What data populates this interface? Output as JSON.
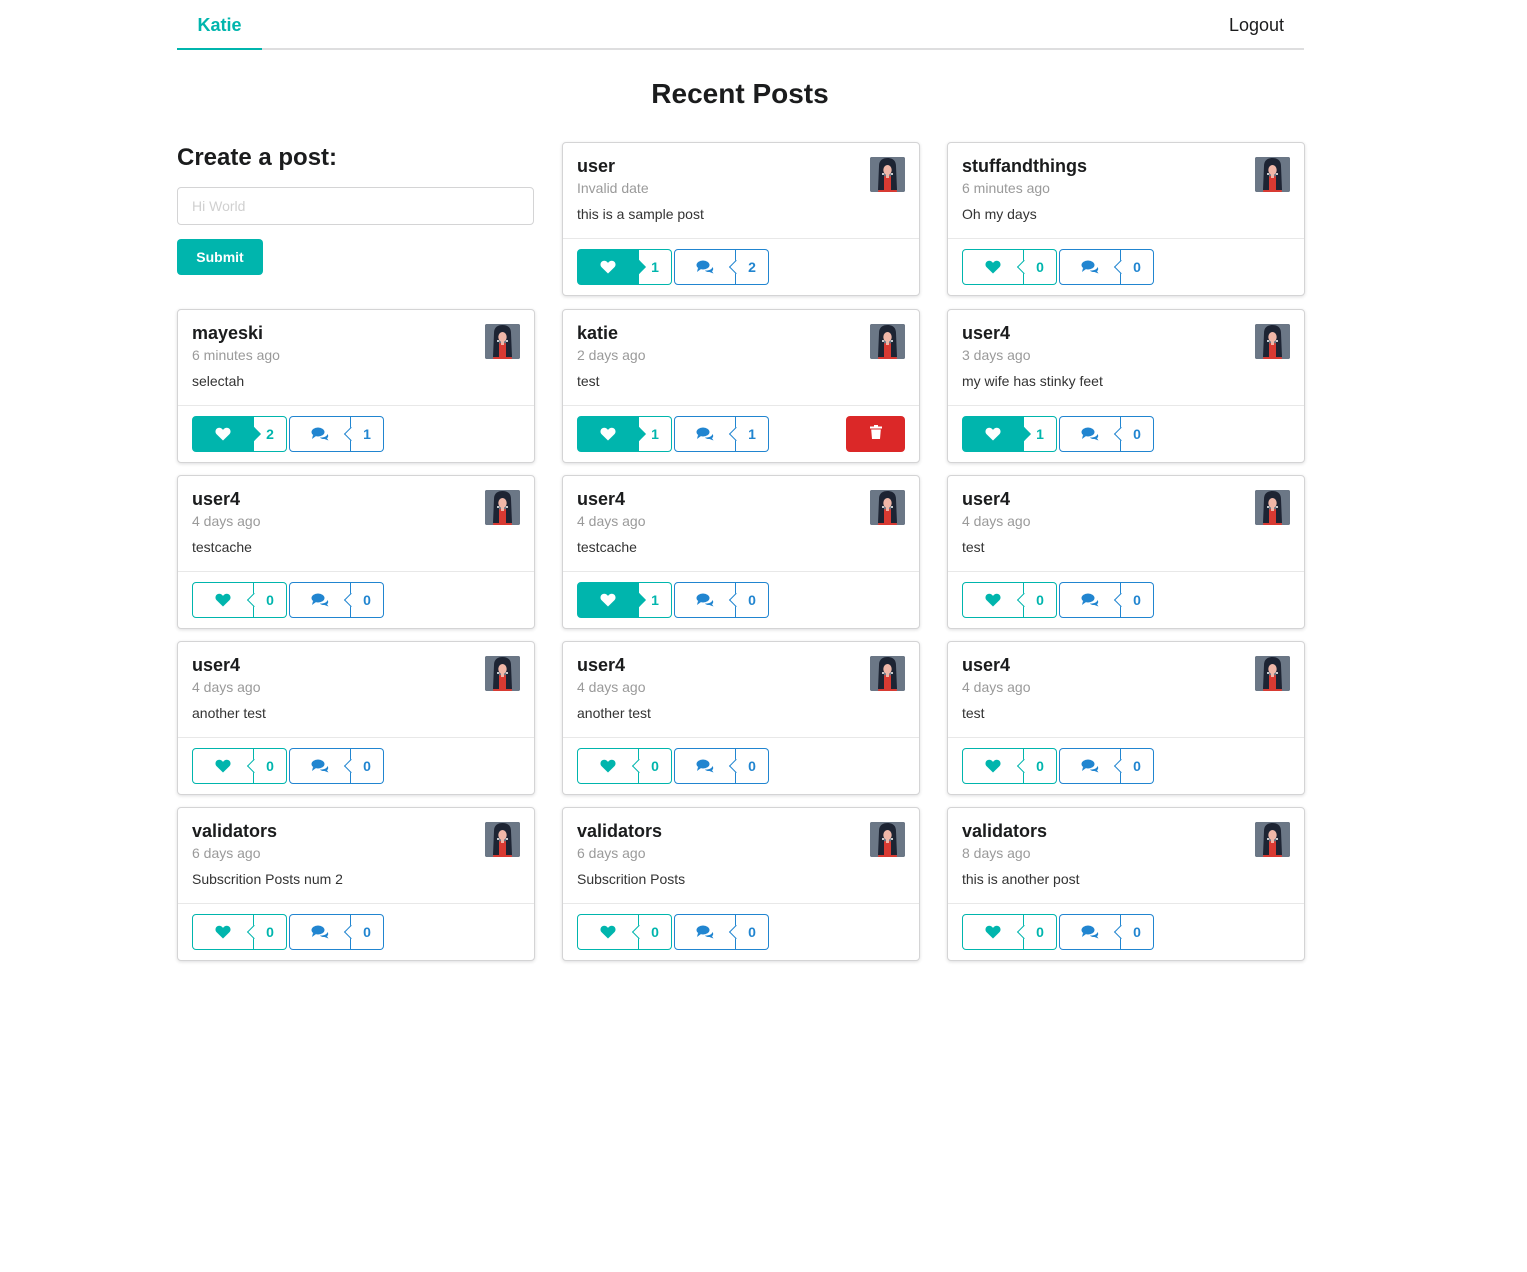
{
  "nav": {
    "user": "Katie",
    "logout": "Logout"
  },
  "page_title": "Recent Posts",
  "create": {
    "title": "Create a post:",
    "placeholder": "Hi World",
    "submit": "Submit"
  },
  "colors": {
    "teal": "#00b5ad",
    "blue": "#2185d0",
    "red": "#db2828"
  },
  "icons": {
    "like": "heart-icon",
    "comment": "comments-icon",
    "delete": "trash-icon",
    "avatar": "user-avatar-image"
  },
  "posts": [
    {
      "user": "user",
      "time": "Invalid date",
      "body": "this is a sample post",
      "likes": "1",
      "liked": true,
      "comments": "2",
      "deletable": false
    },
    {
      "user": "stuffandthings",
      "time": "6 minutes ago",
      "body": "Oh my days",
      "likes": "0",
      "liked": false,
      "comments": "0",
      "deletable": false
    },
    {
      "user": "mayeski",
      "time": "6 minutes ago",
      "body": "selectah",
      "likes": "2",
      "liked": true,
      "comments": "1",
      "deletable": false
    },
    {
      "user": "katie",
      "time": "2 days ago",
      "body": "test",
      "likes": "1",
      "liked": true,
      "comments": "1",
      "deletable": true
    },
    {
      "user": "user4",
      "time": "3 days ago",
      "body": "my wife has stinky feet",
      "likes": "1",
      "liked": true,
      "comments": "0",
      "deletable": false
    },
    {
      "user": "user4",
      "time": "4 days ago",
      "body": "testcache",
      "likes": "0",
      "liked": false,
      "comments": "0",
      "deletable": false
    },
    {
      "user": "user4",
      "time": "4 days ago",
      "body": "testcache",
      "likes": "1",
      "liked": true,
      "comments": "0",
      "deletable": false
    },
    {
      "user": "user4",
      "time": "4 days ago",
      "body": "test",
      "likes": "0",
      "liked": false,
      "comments": "0",
      "deletable": false
    },
    {
      "user": "user4",
      "time": "4 days ago",
      "body": "another test",
      "likes": "0",
      "liked": false,
      "comments": "0",
      "deletable": false
    },
    {
      "user": "user4",
      "time": "4 days ago",
      "body": "another test",
      "likes": "0",
      "liked": false,
      "comments": "0",
      "deletable": false
    },
    {
      "user": "user4",
      "time": "4 days ago",
      "body": "test",
      "likes": "0",
      "liked": false,
      "comments": "0",
      "deletable": false
    },
    {
      "user": "validators",
      "time": "6 days ago",
      "body": "Subscrition Posts num 2",
      "likes": "0",
      "liked": false,
      "comments": "0",
      "deletable": false
    },
    {
      "user": "validators",
      "time": "6 days ago",
      "body": "Subscrition Posts",
      "likes": "0",
      "liked": false,
      "comments": "0",
      "deletable": false
    },
    {
      "user": "validators",
      "time": "8 days ago",
      "body": "this is another post",
      "likes": "0",
      "liked": false,
      "comments": "0",
      "deletable": false
    }
  ]
}
